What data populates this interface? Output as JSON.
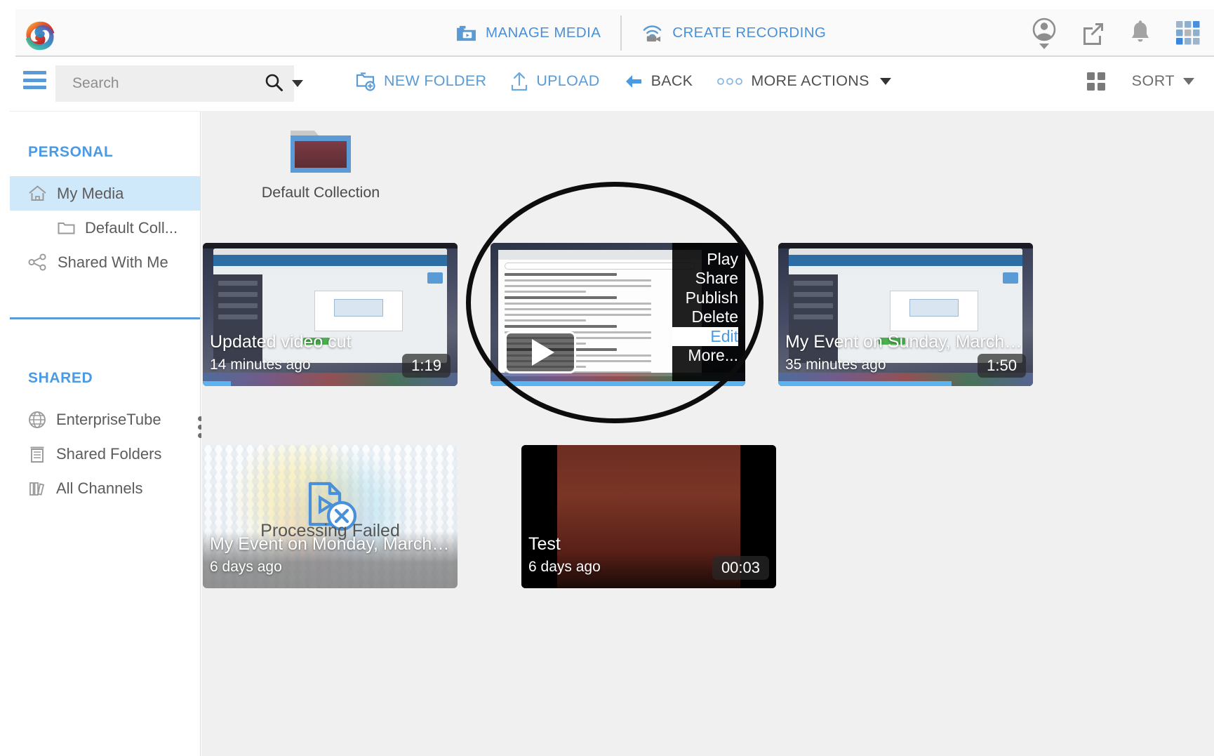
{
  "app": {
    "name": "Media Management Portal",
    "brand_color": "#5b9bd5"
  },
  "topbar": {
    "logo_name": "rainbow-swirl-logo",
    "nav": [
      {
        "label": "MANAGE MEDIA",
        "icon": "folder-play-icon"
      },
      {
        "label": "CREATE RECORDING",
        "icon": "wifi-camera-icon"
      }
    ],
    "right_icons": [
      {
        "name": "account-icon",
        "label": "Account"
      },
      {
        "name": "external-link-icon",
        "label": "Open in new window"
      },
      {
        "name": "notifications-bell-icon",
        "label": "Notifications"
      },
      {
        "name": "app-grid-icon",
        "label": "Apps"
      }
    ]
  },
  "toolbar": {
    "menu_icon": "hamburger-menu-icon",
    "search": {
      "placeholder": "Search",
      "value": "",
      "icon": "search-icon",
      "dropdown_icon": "chevron-down-icon"
    },
    "actions": [
      {
        "label": "NEW FOLDER",
        "icon": "new-folder-icon",
        "style": "blue"
      },
      {
        "label": "UPLOAD",
        "icon": "upload-icon",
        "style": "blue"
      },
      {
        "label": "BACK",
        "icon": "back-arrow-icon",
        "style": "dark"
      },
      {
        "label": "MORE ACTIONS",
        "icon": "three-dots-icon",
        "style": "dark"
      }
    ],
    "view_toggle_icon": "grid-view-icon",
    "sort_label": "SORT",
    "sort_caret_icon": "caret-down-icon"
  },
  "sidebar": {
    "sections": [
      {
        "title": "PERSONAL",
        "items": [
          {
            "label": "My Media",
            "icon": "home-icon",
            "active": true,
            "sub": false
          },
          {
            "label": "Default Coll...",
            "icon": "folder-icon",
            "active": false,
            "sub": true
          },
          {
            "label": "Shared With Me",
            "icon": "share-nodes-icon",
            "active": false,
            "sub": false
          }
        ]
      },
      {
        "title": "SHARED",
        "items": [
          {
            "label": "EnterpriseTube",
            "icon": "globe-icon",
            "active": false,
            "sub": false
          },
          {
            "label": "Shared Folders",
            "icon": "building-icon",
            "active": false,
            "sub": false
          },
          {
            "label": "All Channels",
            "icon": "library-icon",
            "active": false,
            "sub": false
          }
        ]
      }
    ],
    "resize_handle_icon": "vertical-dots-icon"
  },
  "content": {
    "folders": [
      {
        "label": "Default Collection",
        "icon": "collection-folder-icon"
      }
    ],
    "tiles": [
      {
        "title": "Updated video cut",
        "subtitle": "14 minutes ago",
        "duration": "1:19",
        "kind": "screen-capture",
        "progress": true,
        "menu_open": false,
        "play_button": false
      },
      {
        "title": "",
        "subtitle": "",
        "duration": "",
        "kind": "document-capture",
        "progress": true,
        "menu_open": true,
        "play_button": true
      },
      {
        "title": "My Event on Sunday, March 22, ...",
        "subtitle": "35 minutes ago",
        "duration": "1:50",
        "kind": "screen-capture",
        "progress": true,
        "menu_open": false,
        "play_button": false
      },
      {
        "title": "My Event on Monday, March 16, ...",
        "subtitle": "6 days ago",
        "duration": "",
        "kind": "processing-failed",
        "status_text": "Processing Failed",
        "progress": false,
        "menu_open": false,
        "play_button": false
      },
      {
        "title": "Test",
        "subtitle": "6 days ago",
        "duration": "00:03",
        "kind": "video-black-bars",
        "progress": false,
        "menu_open": false,
        "play_button": false
      }
    ],
    "context_menu": {
      "items": [
        {
          "label": "Play",
          "selected": false
        },
        {
          "label": "Share",
          "selected": false
        },
        {
          "label": "Publish",
          "selected": false
        },
        {
          "label": "Delete",
          "selected": false
        },
        {
          "label": "Edit",
          "selected": true
        },
        {
          "label": "More...",
          "selected": false
        }
      ]
    },
    "annotation": {
      "shape": "ellipse-highlight",
      "color": "#0d0d0d"
    }
  }
}
